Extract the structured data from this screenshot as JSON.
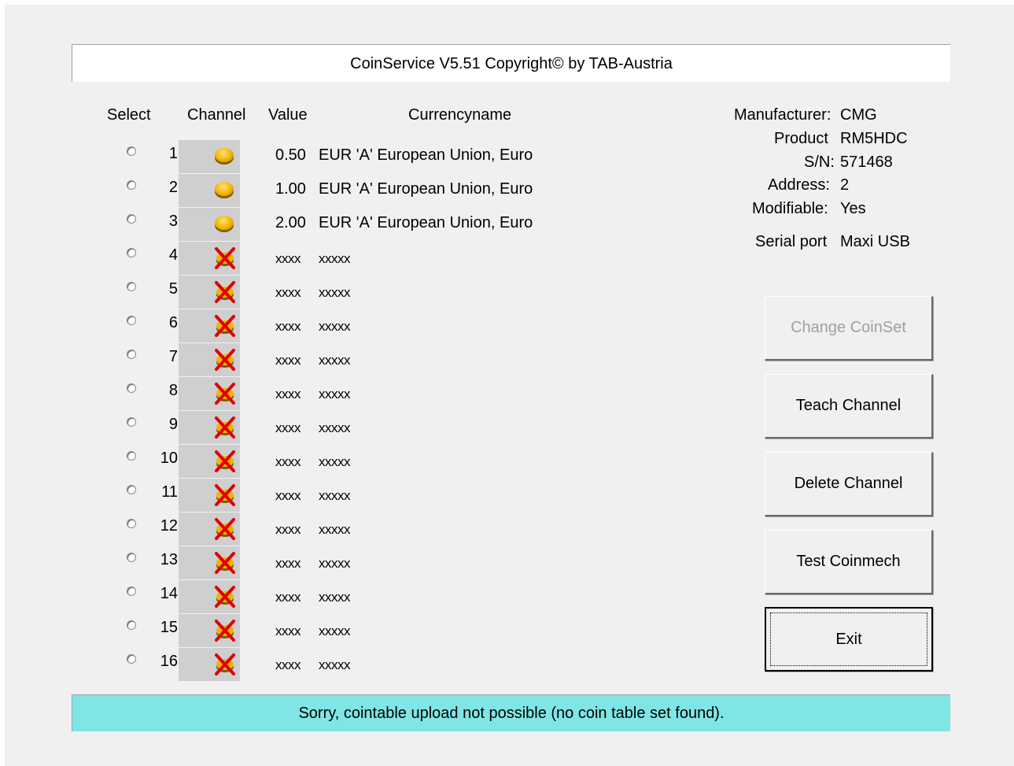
{
  "title": "CoinService V5.51 Copyright© by TAB-Austria",
  "headers": {
    "select": "Select",
    "channel": "Channel",
    "value": "Value",
    "currencyname": "Currencyname"
  },
  "channels": [
    {
      "num": "1",
      "value": "0.50",
      "currency": "EUR 'A' European Union, Euro",
      "icon": "coin-icon"
    },
    {
      "num": "2",
      "value": "1.00",
      "currency": "EUR 'A' European Union, Euro",
      "icon": "coin-icon"
    },
    {
      "num": "3",
      "value": "2.00",
      "currency": "EUR 'A' European Union, Euro",
      "icon": "coin-icon"
    },
    {
      "num": "4",
      "value": "xxxx",
      "currency": "xxxxx",
      "icon": "disabled-coin-icon"
    },
    {
      "num": "5",
      "value": "xxxx",
      "currency": "xxxxx",
      "icon": "disabled-coin-icon"
    },
    {
      "num": "6",
      "value": "xxxx",
      "currency": "xxxxx",
      "icon": "disabled-coin-icon"
    },
    {
      "num": "7",
      "value": "xxxx",
      "currency": "xxxxx",
      "icon": "disabled-coin-icon"
    },
    {
      "num": "8",
      "value": "xxxx",
      "currency": "xxxxx",
      "icon": "disabled-coin-icon"
    },
    {
      "num": "9",
      "value": "xxxx",
      "currency": "xxxxx",
      "icon": "disabled-coin-icon"
    },
    {
      "num": "10",
      "value": "xxxx",
      "currency": "xxxxx",
      "icon": "disabled-coin-icon"
    },
    {
      "num": "11",
      "value": "xxxx",
      "currency": "xxxxx",
      "icon": "disabled-coin-icon"
    },
    {
      "num": "12",
      "value": "xxxx",
      "currency": "xxxxx",
      "icon": "disabled-coin-icon"
    },
    {
      "num": "13",
      "value": "xxxx",
      "currency": "xxxxx",
      "icon": "disabled-coin-icon"
    },
    {
      "num": "14",
      "value": "xxxx",
      "currency": "xxxxx",
      "icon": "disabled-coin-icon"
    },
    {
      "num": "15",
      "value": "xxxx",
      "currency": "xxxxx",
      "icon": "disabled-coin-icon"
    },
    {
      "num": "16",
      "value": "xxxx",
      "currency": "xxxxx",
      "icon": "disabled-coin-icon"
    }
  ],
  "device": {
    "manufacturer_label": "Manufacturer:",
    "manufacturer": "CMG",
    "product_label": "Product",
    "product": "RM5HDC",
    "serial_label": "S/N:",
    "serial": "571468",
    "address_label": "Address:",
    "address": "2",
    "modifiable_label": "Modifiable:",
    "modifiable": "Yes",
    "port_label": "Serial port",
    "port": "Maxi USB"
  },
  "buttons": {
    "change_coinset": "Change CoinSet",
    "teach_channel": "Teach Channel",
    "delete_channel": "Delete Channel",
    "test_coinmech": "Test Coinmech",
    "exit": "Exit"
  },
  "status": "Sorry, cointable upload not possible (no coin table set found).",
  "colors": {
    "status_bg": "#80e5e5",
    "window_bg": "#f0f0f0",
    "icon_cell_bg": "#cfcfcf",
    "coin_gold": "#f2b400",
    "cross_red": "#e00000"
  }
}
